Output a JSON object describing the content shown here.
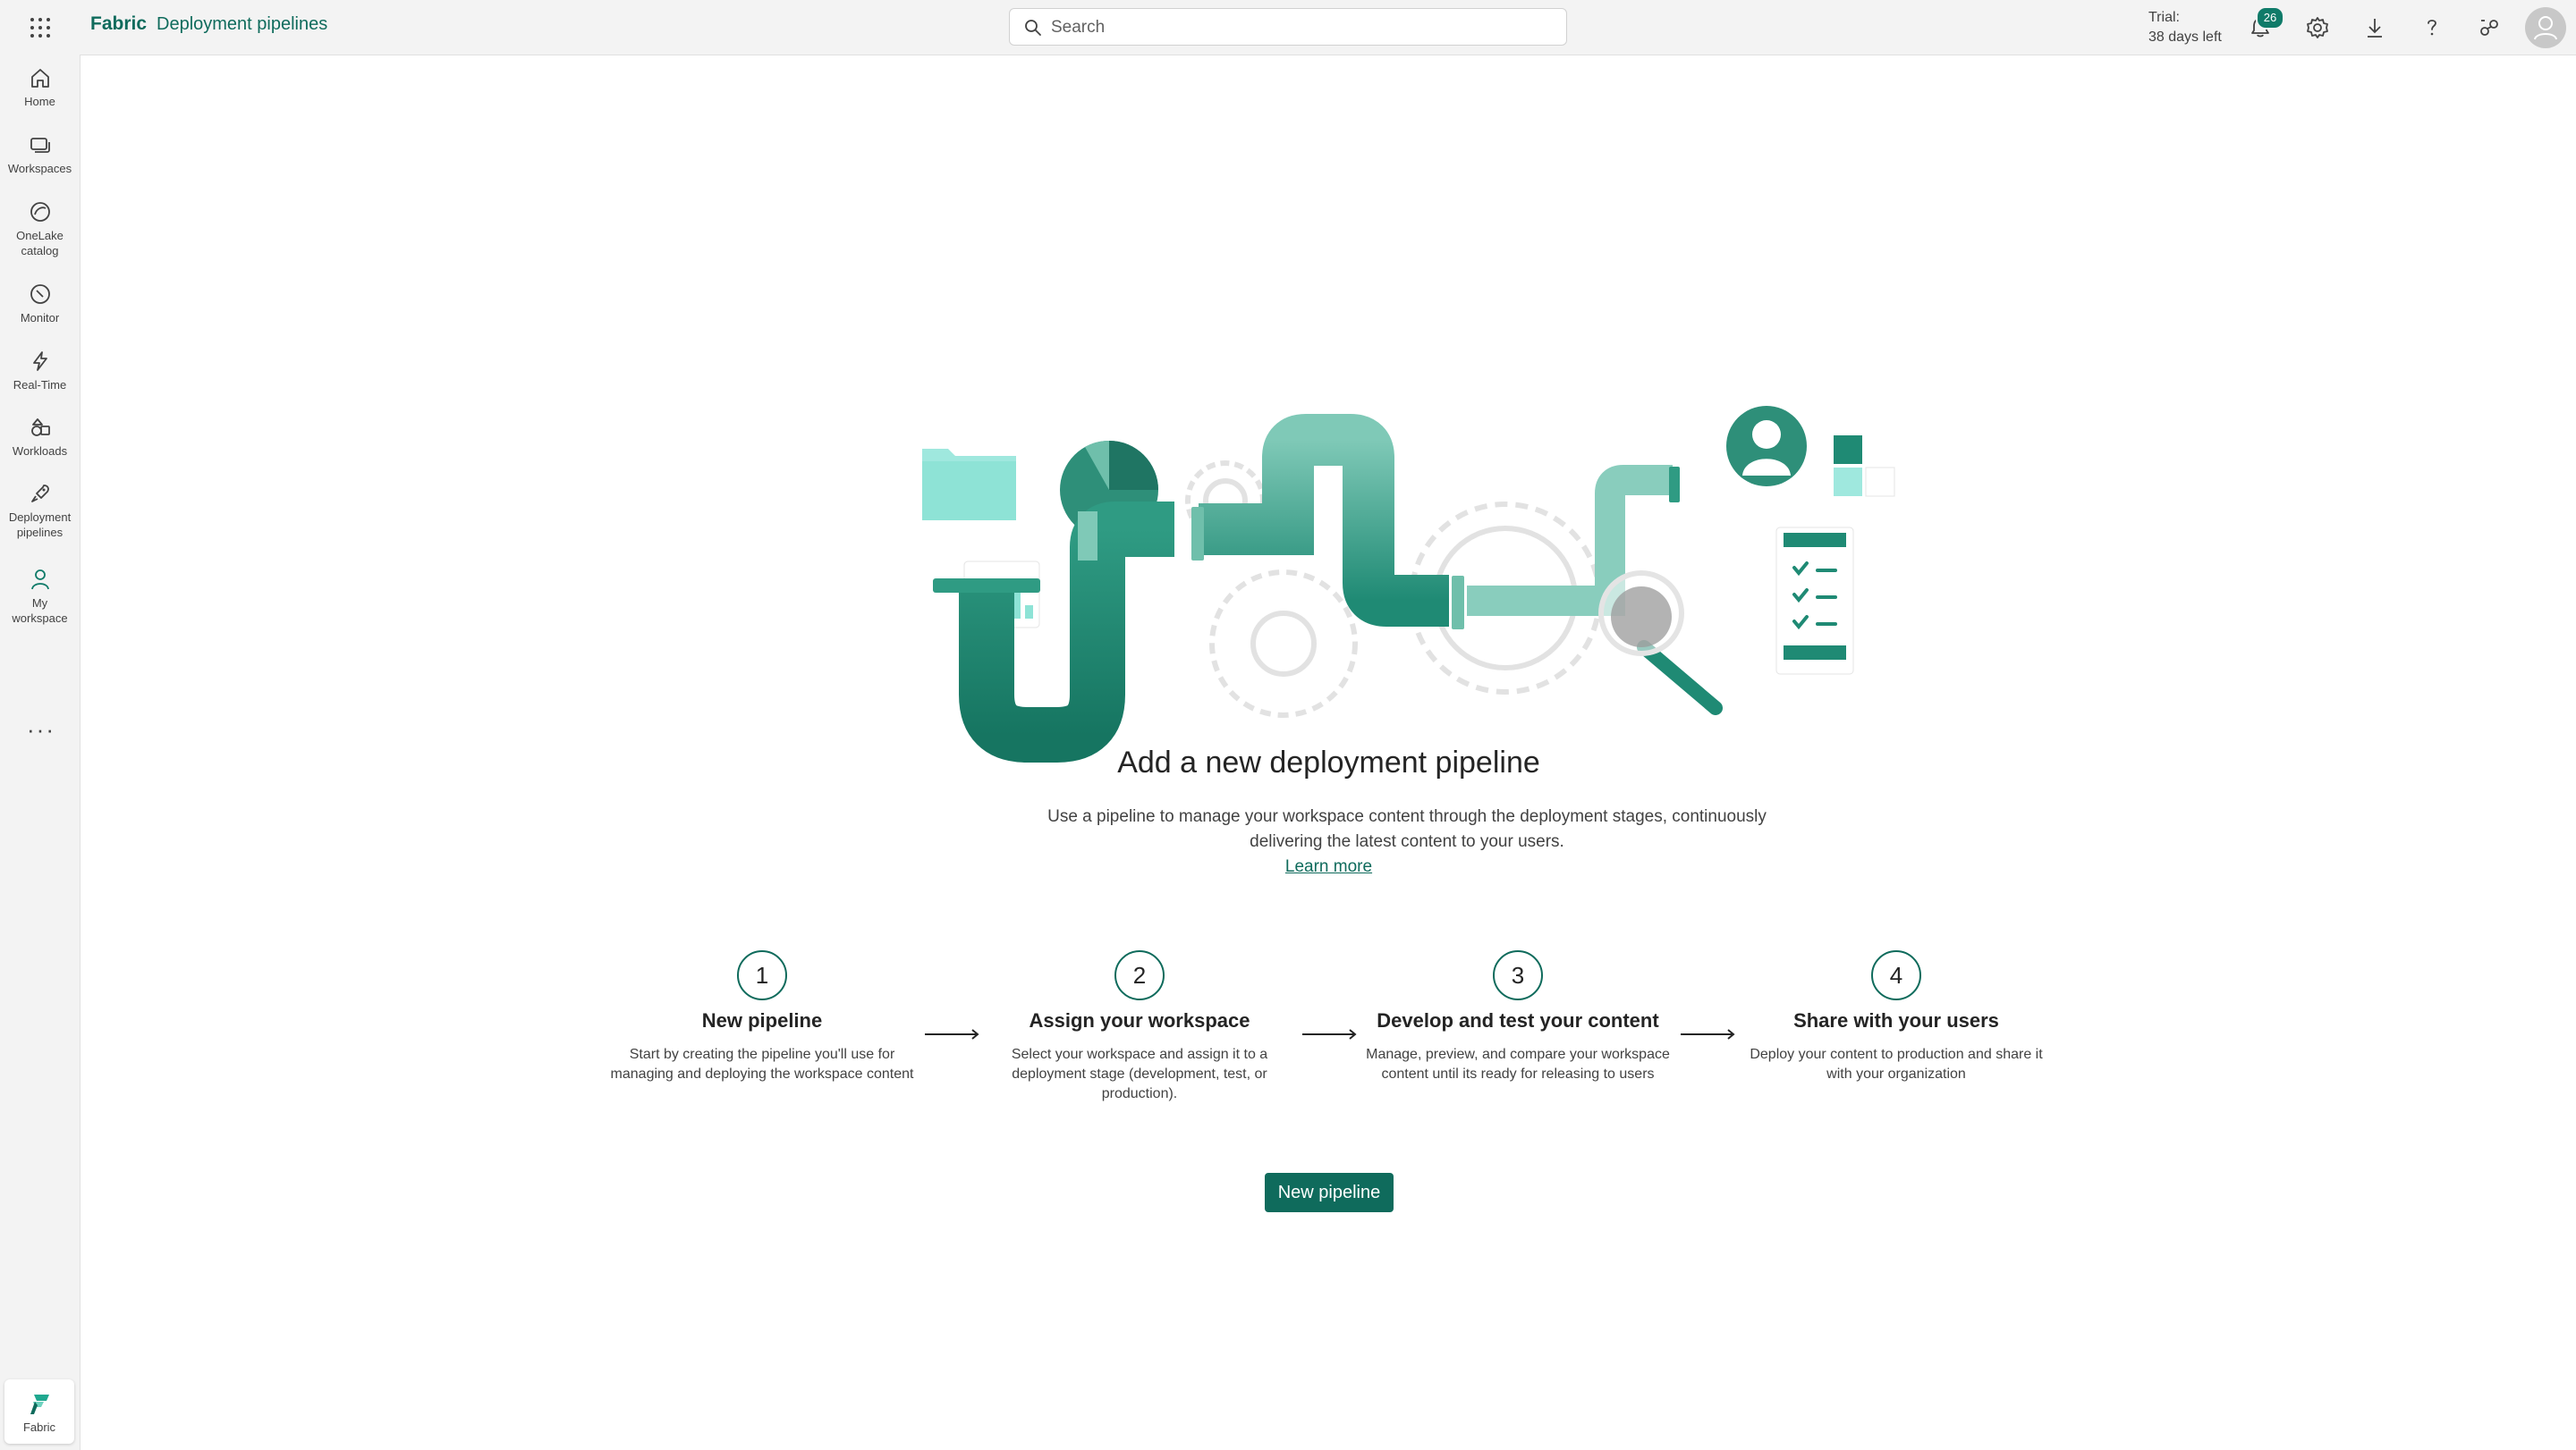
{
  "header": {
    "brand": "Fabric",
    "breadcrumb": "Deployment pipelines",
    "search_placeholder": "Search",
    "trial_line1": "Trial:",
    "trial_line2": "38 days left",
    "notification_count": "26",
    "icons": [
      "app-launcher-icon",
      "search-icon",
      "bell-icon",
      "gear-icon",
      "download-icon",
      "help-icon",
      "share-icon",
      "avatar"
    ]
  },
  "sidebar": {
    "items": [
      {
        "label": "Home",
        "icon": "home-icon"
      },
      {
        "label": "Workspaces",
        "icon": "workspaces-icon"
      },
      {
        "label": "OneLake catalog",
        "icon": "onelake-icon"
      },
      {
        "label": "Monitor",
        "icon": "monitor-icon"
      },
      {
        "label": "Real-Time",
        "icon": "realtime-icon"
      },
      {
        "label": "Workloads",
        "icon": "workloads-icon"
      },
      {
        "label": "Deployment pipelines",
        "icon": "deployment-pipelines-icon"
      },
      {
        "label": "My workspace",
        "icon": "my-workspace-icon"
      }
    ],
    "more": "···",
    "footer_label": "Fabric"
  },
  "main": {
    "title": "Add a new deployment pipeline",
    "description": "Use a pipeline to manage your workspace content through the deployment stages, continuously delivering the latest content to your users.",
    "learn_more": "Learn more",
    "steps": [
      {
        "number": "1",
        "title": "New pipeline",
        "desc": "Start by creating the pipeline you'll use for managing and deploying the workspace content"
      },
      {
        "number": "2",
        "title": "Assign your workspace",
        "desc": "Select your workspace and assign it to a deployment stage (development, test, or production)."
      },
      {
        "number": "3",
        "title": "Develop and test your content",
        "desc": "Manage, preview, and compare your workspace content until its ready for releasing to users"
      },
      {
        "number": "4",
        "title": "Share with your users",
        "desc": "Deploy your content to production and share it with your organization"
      }
    ],
    "new_pipeline_button": "New pipeline"
  },
  "colors": {
    "brand": "#0f6b5c",
    "accent_light": "#8ee3d6",
    "chrome_bg": "#f3f3f3",
    "canvas_bg": "#ffffff"
  }
}
